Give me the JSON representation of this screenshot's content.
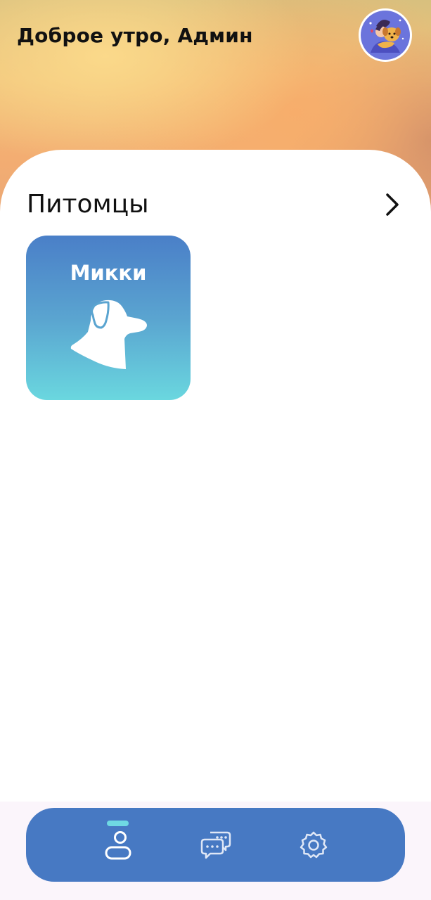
{
  "header": {
    "greeting": "Доброе утро, Админ",
    "avatar_icon": "user-with-dog-avatar"
  },
  "pets_section": {
    "title": "Питомцы",
    "more_icon": "chevron-right-icon",
    "pets": [
      {
        "name": "Микки",
        "icon": "dog-head-icon"
      }
    ]
  },
  "bottom_nav": {
    "items": [
      {
        "icon": "profile-icon",
        "active": true
      },
      {
        "icon": "chat-icon",
        "active": false
      },
      {
        "icon": "settings-gear-icon",
        "active": false
      }
    ]
  },
  "colors": {
    "nav_background": "#4779c3",
    "active_indicator": "#6fd9e3",
    "pet_card_top": "#4a7fc8",
    "pet_card_bottom": "#6ad7df",
    "header_gradient": [
      "#fbd98a",
      "#f3ad72",
      "#c98a6a"
    ]
  }
}
